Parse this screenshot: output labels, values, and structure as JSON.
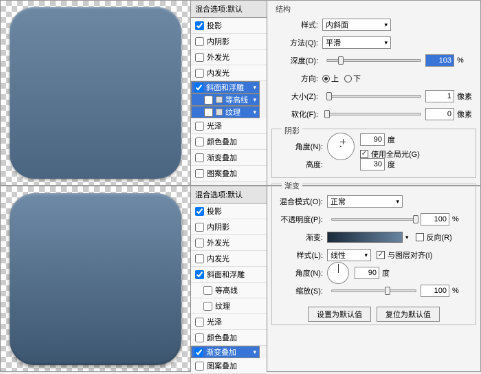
{
  "top": {
    "fx_header": "混合选项:默认",
    "items": [
      {
        "label": "投影",
        "on": true
      },
      {
        "label": "内阴影",
        "on": false
      },
      {
        "label": "外发光",
        "on": false
      },
      {
        "label": "内发光",
        "on": false
      },
      {
        "label": "斜面和浮雕",
        "on": true,
        "sel": true
      },
      {
        "label": "等高线",
        "on": false,
        "sub": true,
        "sel": true,
        "icon": true
      },
      {
        "label": "纹理",
        "on": false,
        "sub": true,
        "sel": true,
        "icon": true
      },
      {
        "label": "光泽",
        "on": false
      },
      {
        "label": "颜色叠加",
        "on": false
      },
      {
        "label": "渐变叠加",
        "on": false
      },
      {
        "label": "图案叠加",
        "on": false
      }
    ],
    "struct_title": "结构",
    "style_lbl": "样式:",
    "style_val": "内斜面",
    "method_lbl": "方法(Q):",
    "method_val": "平滑",
    "depth_lbl": "深度(D):",
    "depth_val": "103",
    "pct": "%",
    "dir_lbl": "方向:",
    "dir_up": "上",
    "dir_down": "下",
    "size_lbl": "大小(Z):",
    "size_val": "1",
    "px": "像素",
    "soften_lbl": "软化(F):",
    "soften_val": "0",
    "shadow_title": "阴影",
    "angle_lbl": "角度(N):",
    "angle_val": "90",
    "deg": "度",
    "global_lbl": "使用全局光(G)",
    "alt_lbl": "高度:",
    "alt_val": "30"
  },
  "bot": {
    "fx_header": "混合选项:默认",
    "items": [
      {
        "label": "投影",
        "on": true
      },
      {
        "label": "内阴影",
        "on": false
      },
      {
        "label": "外发光",
        "on": false
      },
      {
        "label": "内发光",
        "on": false
      },
      {
        "label": "斜面和浮雕",
        "on": true
      },
      {
        "label": "等高线",
        "on": false,
        "sub": true
      },
      {
        "label": "纹理",
        "on": false,
        "sub": true
      },
      {
        "label": "光泽",
        "on": false
      },
      {
        "label": "颜色叠加",
        "on": false
      },
      {
        "label": "渐变叠加",
        "on": true,
        "sel": true
      },
      {
        "label": "图案叠加",
        "on": false
      }
    ],
    "grad_title": "渐变",
    "mode_lbl": "混合模式(O):",
    "mode_val": "正常",
    "opac_lbl": "不透明度(P):",
    "opac_val": "100",
    "pct": "%",
    "grad_lbl": "渐变:",
    "reverse": "反向(R)",
    "style_lbl": "样式(L):",
    "style_val": "线性",
    "align": "与图层对齐(I)",
    "angle_lbl": "角度(N):",
    "angle_val": "90",
    "deg": "度",
    "scale_lbl": "缩放(S):",
    "scale_val": "100",
    "btn_default": "设置为默认值",
    "btn_reset": "复位为默认值"
  }
}
